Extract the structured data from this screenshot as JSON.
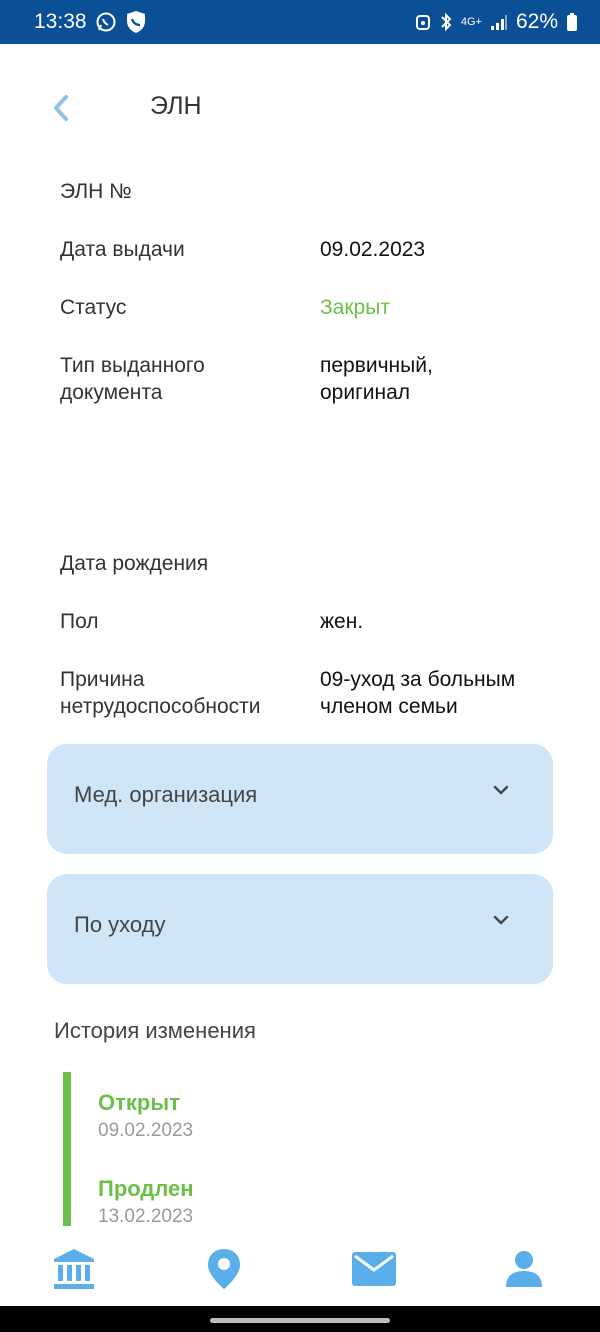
{
  "status_bar": {
    "time": "13:38",
    "network": "4G+",
    "battery": "62%",
    "icons": [
      "whatsapp-icon",
      "shield-icon",
      "alarm-icon",
      "bluetooth-icon",
      "signal-icon",
      "battery-icon"
    ]
  },
  "header": {
    "title": "ЭЛН",
    "back_icon": "chevron-left-icon"
  },
  "details": {
    "number_label": "ЭЛН №",
    "issue_date_label": "Дата выдачи",
    "issue_date_value": "09.02.2023",
    "status_label": "Статус",
    "status_value": "Закрыт",
    "doc_type_label": "Тип выданного документа",
    "doc_type_value": "первичный, оригинал",
    "birth_date_label": "Дата рождения",
    "gender_label": "Пол",
    "gender_value": "жен.",
    "reason_label": "Причина нетрудоспособности",
    "reason_value": "09-уход за больным членом семьи"
  },
  "accordions": [
    {
      "label": "Мед. организация",
      "icon": "chevron-down-icon"
    },
    {
      "label": "По уходу",
      "icon": "chevron-down-icon"
    }
  ],
  "history": {
    "title": "История изменения",
    "events": [
      {
        "status": "Открыт",
        "date": "09.02.2023"
      },
      {
        "status": "Продлен",
        "date": "13.02.2023"
      }
    ]
  },
  "bottom_nav": {
    "items": [
      "bank-icon",
      "location-pin-icon",
      "mail-icon",
      "profile-icon"
    ]
  },
  "colors": {
    "status_bar": "#0b4f97",
    "accent_green": "#6cc04a",
    "accordion_bg": "#cfe6f8",
    "nav_icon": "#5aaee9",
    "back_icon": "#8fc3ea"
  }
}
